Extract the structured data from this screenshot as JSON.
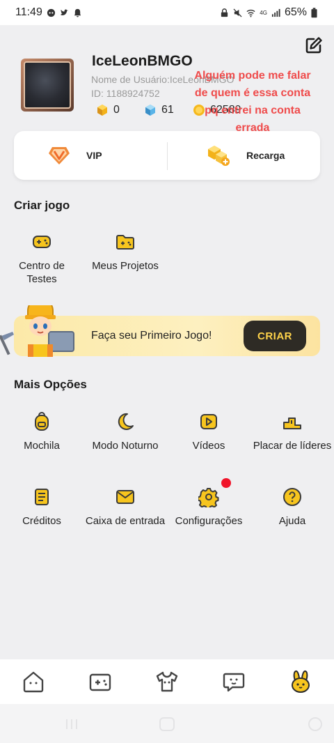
{
  "status_bar": {
    "time": "11:49",
    "battery": "65%",
    "net": "4G"
  },
  "profile": {
    "username": "IceLeonBMGO",
    "user_label": "Nome de Usuário:IceLeonBMGO",
    "id_label": "ID: 1188924752",
    "cubes_gold": "0",
    "cubes_blue": "61",
    "coins": "62589"
  },
  "overlay_note": "Alguém pode me falar de quem é essa conta pq entrei na conta errada",
  "card": {
    "vip_label": "VIP",
    "recharge_label": "Recarga"
  },
  "create_section": {
    "title": "Criar jogo",
    "items": [
      {
        "label": "Centro de\nTestes",
        "icon": "gamepad-icon"
      },
      {
        "label": "Meus Projetos",
        "icon": "folder-game-icon"
      }
    ]
  },
  "banner": {
    "text": "Faça seu Primeiro Jogo!",
    "button": "CRIAR"
  },
  "more_section": {
    "title": "Mais Opções",
    "items": [
      {
        "label": "Mochila",
        "icon": "backpack-icon"
      },
      {
        "label": "Modo Noturno",
        "icon": "moon-icon"
      },
      {
        "label": "Vídeos",
        "icon": "video-icon"
      },
      {
        "label": "Placar de líderes",
        "icon": "podium-icon"
      },
      {
        "label": "Créditos",
        "icon": "credits-icon"
      },
      {
        "label": "Caixa de entrada",
        "icon": "mail-icon"
      },
      {
        "label": "Configurações",
        "icon": "gear-icon"
      },
      {
        "label": "Ajuda",
        "icon": "help-icon"
      }
    ]
  },
  "colors": {
    "accent": "#f7c51e",
    "icon_dark": "#3a3a3a",
    "badge": "#f0142a",
    "note": "#ef4b4b"
  }
}
